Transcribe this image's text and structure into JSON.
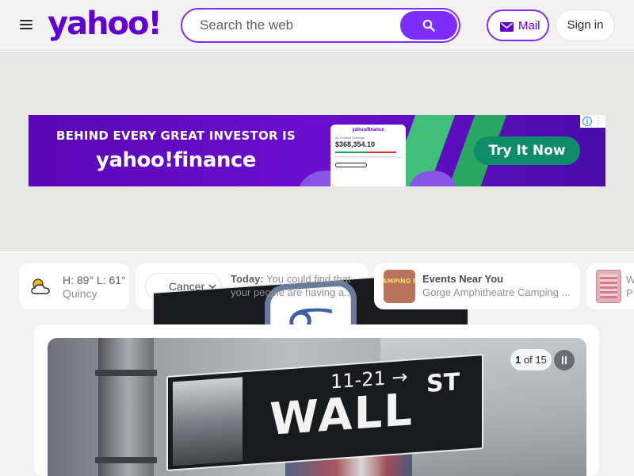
{
  "header": {
    "logo_text": "yahoo!",
    "search_placeholder": "Search the web",
    "mail_label": "Mail",
    "signin_label": "Sign in",
    "icons": [
      "menu-icon",
      "search-icon",
      "mail-icon"
    ]
  },
  "ad": {
    "headline": "BEHIND EVERY GREAT INVESTOR IS",
    "brand": "yahoo!finance",
    "phone_title": "yahoo/finance",
    "phone_label": "All Portfolio Holdings",
    "phone_value": "$368,354.10",
    "cta": "Try It Now",
    "colors": {
      "background": "#6a0fd0",
      "cta": "#0e8c6a"
    }
  },
  "cards": {
    "weather": {
      "temp": "H: 89° L: 61°",
      "location": "Quincy",
      "icon": "partly-cloudy-icon"
    },
    "horoscope": {
      "sign": "Cancer",
      "label": "Today:",
      "text": "You could find that your people are having a..."
    },
    "events": {
      "thumb_text": "AMPING PRESS PASS",
      "title": "Events Near You",
      "subtitle": "Gorge Amphitheatre Camping ..."
    },
    "partial": {
      "line1": "W",
      "line2": "P"
    }
  },
  "hero": {
    "counter_current": "1",
    "counter_suffix": " of 15",
    "sign_number": "11-21 →",
    "sign_main": "WALL",
    "sign_suffix": "ST"
  }
}
